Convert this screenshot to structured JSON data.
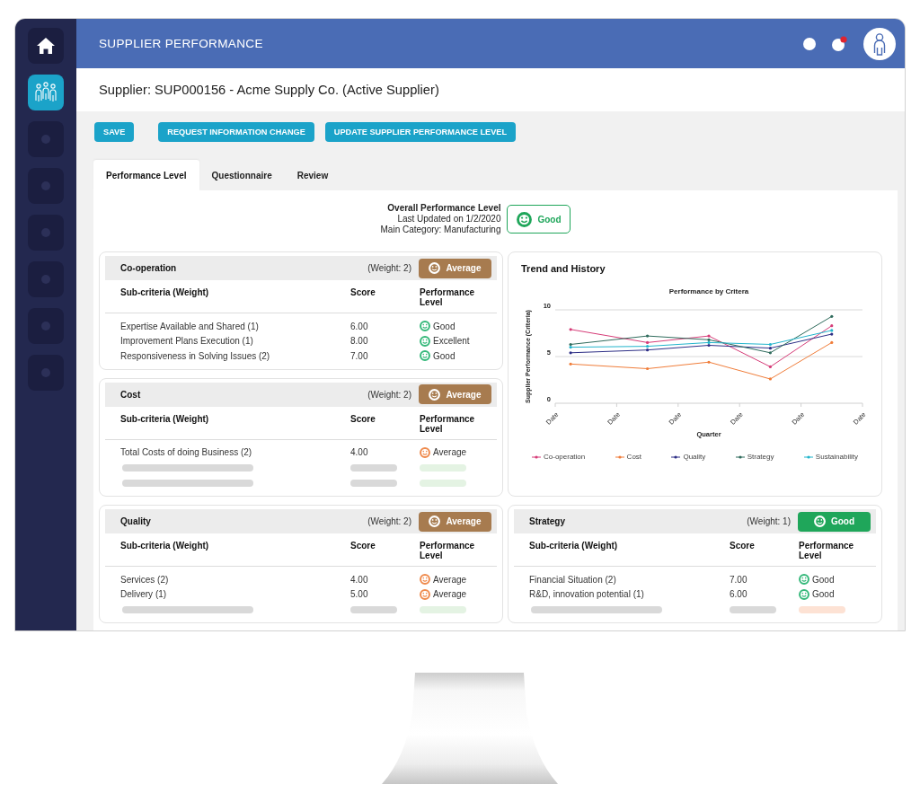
{
  "window": {
    "title": "SUPPLIER PERFORMANCE",
    "alerts_unread": true
  },
  "sidebar": {
    "items": [
      {
        "kind": "home",
        "selected": false
      },
      {
        "kind": "team",
        "selected": true
      },
      {
        "kind": "empty",
        "selected": false
      },
      {
        "kind": "empty",
        "selected": false
      },
      {
        "kind": "empty",
        "selected": false
      },
      {
        "kind": "empty",
        "selected": false
      },
      {
        "kind": "empty",
        "selected": false
      },
      {
        "kind": "empty",
        "selected": false
      }
    ]
  },
  "supplier": {
    "title": "Supplier: SUP000156 - Acme Supply Co. (Active Supplier)"
  },
  "toolbar": {
    "buttons": [
      "SAVE",
      "REQUEST INFORMATION CHANGE",
      "UPDATE SUPPLIER PERFORMANCE LEVEL"
    ]
  },
  "tabs": [
    {
      "label": "Performance Level",
      "selected": true
    },
    {
      "label": "Questionnaire",
      "selected": false
    },
    {
      "label": "Review",
      "selected": false
    }
  ],
  "overall": {
    "title": "Overall Performance Level",
    "updated": "Last Updated on 1/2/2020",
    "category": "Main Category: Manufacturing",
    "badge": {
      "label": "Good",
      "color": "#1fa65a"
    }
  },
  "criteria": [
    {
      "title": "Co-operation",
      "weight": "(Weight: 2)",
      "badge": {
        "label": "Average",
        "color": "#a77b4f"
      },
      "columns": [
        "Sub-criteria (Weight)",
        "Score",
        "Performance Level"
      ],
      "rows": [
        {
          "kind": "entry",
          "name": "Expertise Available and Shared (1)",
          "score": "6.00",
          "rating": "Good",
          "color": "#35b87a"
        },
        {
          "kind": "entry",
          "name": "Improvement Plans Execution (1)",
          "score": "8.00",
          "rating": "Excellent",
          "color": "#35b87a"
        },
        {
          "kind": "entry",
          "name": "Responsiveness in Solving Issues (2)",
          "score": "7.00",
          "rating": "Good",
          "color": "#35b87a"
        }
      ]
    },
    {
      "title": "Cost",
      "weight": "(Weight: 2)",
      "badge": {
        "label": "Average",
        "color": "#a77b4f"
      },
      "columns": [
        "Sub-criteria (Weight)",
        "Score",
        "Performance Level"
      ],
      "rows": [
        {
          "kind": "entry",
          "name": "Total Costs of doing Business (2)",
          "score": "4.00",
          "rating": "Average",
          "color": "#ef8a4c"
        },
        {
          "kind": "placeholder",
          "color": "#e4f3e3"
        },
        {
          "kind": "placeholder",
          "color": "#e4f3e3"
        }
      ]
    },
    {
      "title": "Quality",
      "weight": "(Weight: 2)",
      "badge": {
        "label": "Average",
        "color": "#a77b4f"
      },
      "columns": [
        "Sub-criteria (Weight)",
        "Score",
        "Performance Level"
      ],
      "rows": [
        {
          "kind": "entry",
          "name": "Services (2)",
          "score": "4.00",
          "rating": "Average",
          "color": "#ef8a4c"
        },
        {
          "kind": "entry",
          "name": "Delivery (1)",
          "score": "5.00",
          "rating": "Average",
          "color": "#ef8a4c"
        },
        {
          "kind": "placeholder",
          "color": "#e4f3e3"
        }
      ]
    },
    {
      "title": "Strategy",
      "weight": "(Weight: 1)",
      "badge": {
        "label": "Good",
        "color": "#1fa65a"
      },
      "columns": [
        "Sub-criteria (Weight)",
        "Score",
        "Performance Level"
      ],
      "rows": [
        {
          "kind": "entry",
          "name": "Financial Situation (2)",
          "score": "7.00",
          "rating": "Good",
          "color": "#35b87a"
        },
        {
          "kind": "entry",
          "name": "R&D, innovation potential (1)",
          "score": "6.00",
          "rating": "Good",
          "color": "#35b87a"
        },
        {
          "kind": "placeholder",
          "color": "#fde2d4"
        }
      ]
    }
  ],
  "trend": {
    "title": "Trend and History",
    "chart_data": {
      "type": "line",
      "title": "Performance by Critera",
      "xlabel": "Quarter",
      "ylabel": "Supplier Performance (Criteria)",
      "legend": "bottom",
      "categories": [
        "Date",
        null,
        null,
        null,
        "Date",
        null,
        null,
        null,
        "Date",
        null,
        null,
        null,
        "Date",
        null,
        null,
        null,
        "Date",
        null,
        null,
        null,
        "Date"
      ],
      "ylim": [
        0,
        10
      ],
      "yticks": [
        0,
        5,
        10
      ],
      "series": [
        {
          "name": "Co-operation",
          "color": "#d63c78",
          "values": [
            null,
            7.9,
            null,
            null,
            null,
            null,
            6.5,
            null,
            null,
            null,
            7.2,
            null,
            null,
            null,
            3.9,
            null,
            null,
            null,
            8.3,
            null,
            null
          ]
        },
        {
          "name": "Cost",
          "color": "#f07d3a",
          "values": [
            null,
            4.2,
            null,
            null,
            null,
            null,
            3.7,
            null,
            null,
            null,
            4.4,
            null,
            null,
            null,
            2.6,
            null,
            null,
            null,
            6.5,
            null,
            null
          ]
        },
        {
          "name": "Quality",
          "color": "#2e2f86",
          "values": [
            null,
            5.4,
            null,
            null,
            null,
            null,
            5.7,
            null,
            null,
            null,
            6.2,
            null,
            null,
            null,
            5.9,
            null,
            null,
            null,
            7.4,
            null,
            null
          ]
        },
        {
          "name": "Strategy",
          "color": "#2f6b5c",
          "values": [
            null,
            6.3,
            null,
            null,
            null,
            null,
            7.2,
            null,
            null,
            null,
            6.8,
            null,
            null,
            null,
            5.4,
            null,
            null,
            null,
            9.3,
            null,
            null
          ]
        },
        {
          "name": "Sustainability",
          "color": "#22b5cc",
          "values": [
            null,
            6.0,
            null,
            null,
            null,
            null,
            6.1,
            null,
            null,
            null,
            6.5,
            null,
            null,
            null,
            6.3,
            null,
            null,
            null,
            7.8,
            null,
            null
          ]
        }
      ]
    }
  }
}
